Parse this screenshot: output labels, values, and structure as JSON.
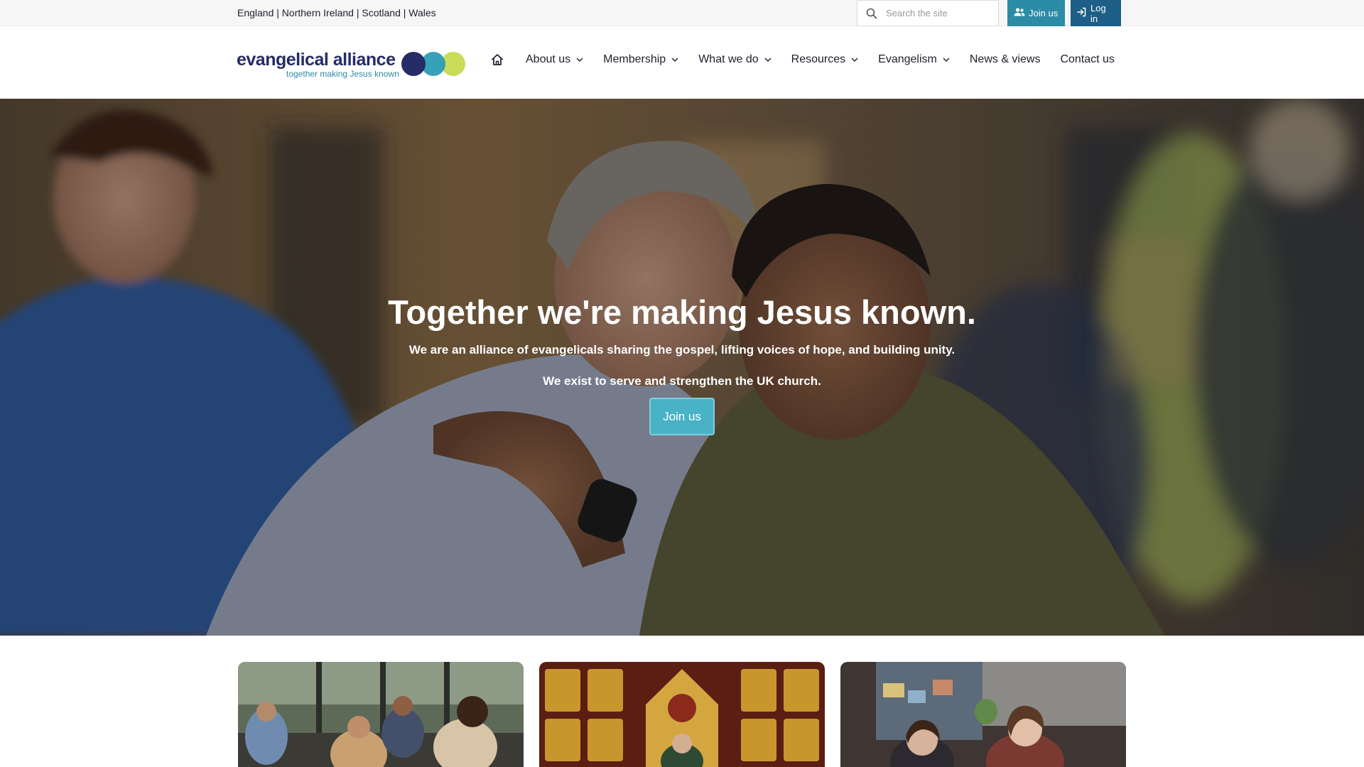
{
  "utility": {
    "nations": "England | Northern Ireland | Scotland | Wales",
    "search_placeholder": "Search the site",
    "join_label": "Join us",
    "login_label": "Log in"
  },
  "logo": {
    "name": "evangelical alliance",
    "tagline": "together making Jesus known"
  },
  "nav": {
    "items": [
      {
        "label": "About us",
        "icon": "chevron-down-icon"
      },
      {
        "label": "Membership",
        "icon": "chevron-down-icon"
      },
      {
        "label": "What we do",
        "icon": "chevron-down-icon"
      },
      {
        "label": "Resources",
        "icon": "chevron-down-icon"
      },
      {
        "label": "Evangelism",
        "icon": "chevron-down-icon"
      },
      {
        "label": "News & views"
      },
      {
        "label": "Contact us"
      }
    ]
  },
  "hero": {
    "title": "Together we're making Jesus known.",
    "line1": "We are an alliance of evangelicals sharing the gospel, lifting voices of hope, and building unity.",
    "line2": "We exist to serve and strengthen the UK church.",
    "cta": "Join us"
  },
  "colors": {
    "brand_navy": "#262c67",
    "brand_teal": "#2c8ba5",
    "brand_lime": "#c9dc5a",
    "login_blue": "#1d5f86",
    "cta_teal": "#49b2c6"
  }
}
